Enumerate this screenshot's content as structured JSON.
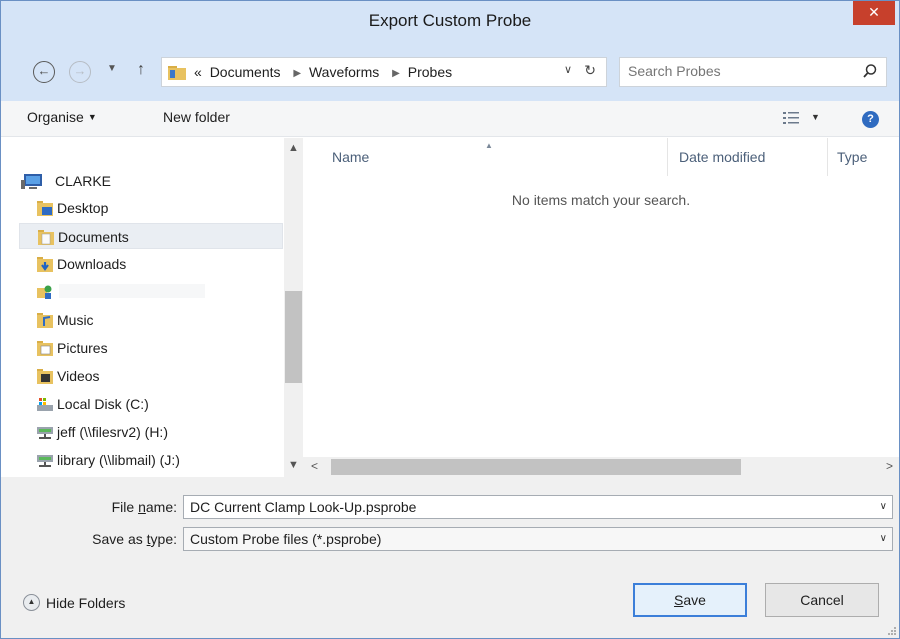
{
  "window": {
    "title": "Export Custom Probe"
  },
  "address": {
    "breadcrumb_overflow": "«",
    "crumbs": [
      "Documents",
      "Waveforms",
      "Probes"
    ]
  },
  "search": {
    "placeholder": "Search Probes"
  },
  "toolbar": {
    "organise_label": "Organise",
    "new_folder_label": "New folder"
  },
  "nav_tree": {
    "root": "CLARKE",
    "items": [
      {
        "label": "Desktop",
        "icon": "desktop-folder-icon"
      },
      {
        "label": "Documents",
        "icon": "documents-folder-icon",
        "selected": true
      },
      {
        "label": "Downloads",
        "icon": "downloads-folder-icon"
      },
      {
        "label": "",
        "icon": "network-user-icon"
      },
      {
        "label": "Music",
        "icon": "music-folder-icon"
      },
      {
        "label": "Pictures",
        "icon": "pictures-folder-icon"
      },
      {
        "label": "Videos",
        "icon": "videos-folder-icon"
      },
      {
        "label": "Local Disk (C:)",
        "icon": "local-disk-icon"
      },
      {
        "label": "jeff (\\\\filesrv2) (H:)",
        "icon": "network-drive-icon"
      },
      {
        "label": "library (\\\\libmail) (J:)",
        "icon": "network-drive-icon"
      }
    ]
  },
  "file_list": {
    "columns": [
      "Name",
      "Date modified",
      "Type"
    ],
    "empty_message": "No items match your search."
  },
  "form": {
    "file_name_label_pre": "File ",
    "file_name_label_u": "n",
    "file_name_label_post": "ame:",
    "file_name_value": "DC Current Clamp Look-Up.psprobe",
    "save_type_label_pre": "Save as ",
    "save_type_label_u": "t",
    "save_type_label_post": "ype:",
    "save_type_value": "Custom Probe files (*.psprobe)"
  },
  "footer": {
    "hide_folders_label": "Hide Folders",
    "save_label_u": "S",
    "save_label_rest": "ave",
    "cancel_label": "Cancel"
  },
  "colors": {
    "accent": "#3c7fd9",
    "titlebar": "#d5e4f7",
    "close": "#c7402c"
  }
}
